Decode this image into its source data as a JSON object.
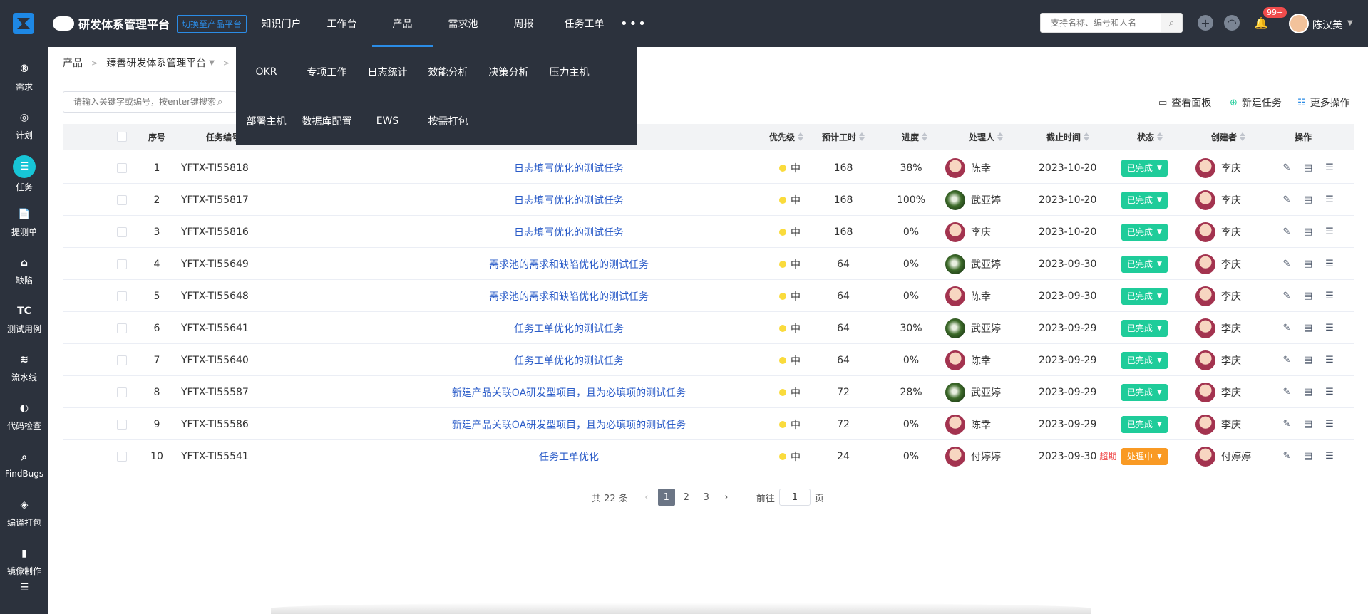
{
  "header": {
    "app_title": "研发体系管理平台",
    "switch_label": "切换至产品平台",
    "nav": [
      "知识门户",
      "工作台",
      "产品",
      "需求池",
      "周报",
      "任务工单"
    ],
    "more": "•••",
    "search_placeholder": "支持名称、编号和人名",
    "notification_count": "99+",
    "user_name": "陈汉美"
  },
  "sidebar": [
    {
      "label": "需求",
      "icon": "®"
    },
    {
      "label": "计划",
      "icon": "◎"
    },
    {
      "label": "任务",
      "icon": "☰"
    },
    {
      "label": "提测单",
      "icon": "📄"
    },
    {
      "label": "缺陷",
      "icon": "⌂"
    },
    {
      "label": "测试用例",
      "icon": "TC"
    },
    {
      "label": "流水线",
      "icon": "≋"
    },
    {
      "label": "代码检查",
      "icon": "◐"
    },
    {
      "label": "FindBugs",
      "icon": "⌕"
    },
    {
      "label": "编译打包",
      "icon": "◈"
    },
    {
      "label": "镜像制作",
      "icon": "▮"
    },
    {
      "label": "",
      "icon": "☰"
    }
  ],
  "breadcrumb": [
    "产品",
    "臻善研发体系管理平台"
  ],
  "filter_placeholder": "请输入关键字或编号，按enter键搜索",
  "actions": {
    "view_panel": "查看面板",
    "new_task": "新建任务",
    "more_ops": "更多操作"
  },
  "dropdown": [
    "OKR",
    "专项工作",
    "日志统计",
    "效能分析",
    "决策分析",
    "压力主机",
    "部署主机",
    "数据库配置",
    "EWS",
    "按需打包"
  ],
  "table": {
    "headers": {
      "index": "序号",
      "code": "任务编号",
      "priority": "优先级",
      "hours": "预计工时",
      "progress": "进度",
      "assignee": "处理人",
      "deadline": "截止时间",
      "status": "状态",
      "creator": "创建者",
      "ops": "操作"
    },
    "rows": [
      {
        "index": "1",
        "code": "YFTX-TI55818",
        "name": "日志填写优化的测试任务",
        "priority": "中",
        "hours": "168",
        "progress": "38%",
        "assignee": "陈幸",
        "av": "pink",
        "deadline": "2023-10-20",
        "overdue": "",
        "status": "已完成",
        "creator": "李庆"
      },
      {
        "index": "2",
        "code": "YFTX-TI55817",
        "name": "日志填写优化的测试任务",
        "priority": "中",
        "hours": "168",
        "progress": "100%",
        "assignee": "武亚婷",
        "av": "green",
        "deadline": "2023-10-20",
        "overdue": "",
        "status": "已完成",
        "creator": "李庆"
      },
      {
        "index": "3",
        "code": "YFTX-TI55816",
        "name": "日志填写优化的测试任务",
        "priority": "中",
        "hours": "168",
        "progress": "0%",
        "assignee": "李庆",
        "av": "pink",
        "deadline": "2023-10-20",
        "overdue": "",
        "status": "已完成",
        "creator": "李庆"
      },
      {
        "index": "4",
        "code": "YFTX-TI55649",
        "name": "需求池的需求和缺陷优化的测试任务",
        "priority": "中",
        "hours": "64",
        "progress": "0%",
        "assignee": "武亚婷",
        "av": "green",
        "deadline": "2023-09-30",
        "overdue": "",
        "status": "已完成",
        "creator": "李庆"
      },
      {
        "index": "5",
        "code": "YFTX-TI55648",
        "name": "需求池的需求和缺陷优化的测试任务",
        "priority": "中",
        "hours": "64",
        "progress": "0%",
        "assignee": "陈幸",
        "av": "pink",
        "deadline": "2023-09-30",
        "overdue": "",
        "status": "已完成",
        "creator": "李庆"
      },
      {
        "index": "6",
        "code": "YFTX-TI55641",
        "name": "任务工单优化的测试任务",
        "priority": "中",
        "hours": "64",
        "progress": "30%",
        "assignee": "武亚婷",
        "av": "green",
        "deadline": "2023-09-29",
        "overdue": "",
        "status": "已完成",
        "creator": "李庆"
      },
      {
        "index": "7",
        "code": "YFTX-TI55640",
        "name": "任务工单优化的测试任务",
        "priority": "中",
        "hours": "64",
        "progress": "0%",
        "assignee": "陈幸",
        "av": "pink",
        "deadline": "2023-09-29",
        "overdue": "",
        "status": "已完成",
        "creator": "李庆"
      },
      {
        "index": "8",
        "code": "YFTX-TI55587",
        "name": "新建产品关联OA研发型项目，且为必填项的测试任务",
        "priority": "中",
        "hours": "72",
        "progress": "28%",
        "assignee": "武亚婷",
        "av": "green",
        "deadline": "2023-09-29",
        "overdue": "",
        "status": "已完成",
        "creator": "李庆"
      },
      {
        "index": "9",
        "code": "YFTX-TI55586",
        "name": "新建产品关联OA研发型项目，且为必填项的测试任务",
        "priority": "中",
        "hours": "72",
        "progress": "0%",
        "assignee": "陈幸",
        "av": "pink",
        "deadline": "2023-09-29",
        "overdue": "",
        "status": "已完成",
        "creator": "李庆"
      },
      {
        "index": "10",
        "code": "YFTX-TI55541",
        "name": "任务工单优化",
        "priority": "中",
        "hours": "24",
        "progress": "0%",
        "assignee": "付婷婷",
        "av": "pink",
        "deadline": "2023-09-30",
        "overdue": "超期",
        "status": "处理中",
        "creator": "付婷婷"
      }
    ]
  },
  "pagination": {
    "total": "共 22 条",
    "pages": [
      "1",
      "2",
      "3"
    ],
    "current": "1",
    "goto": "前往",
    "goto_value": "1",
    "page_unit": "页"
  },
  "colors": {
    "topbar": "#2c323d",
    "accent": "#2b8ce6",
    "done": "#1fcc9a",
    "doing": "#f99a24",
    "link": "#2b5cc8"
  }
}
